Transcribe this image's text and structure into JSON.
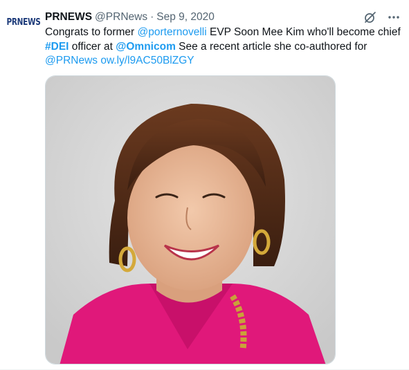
{
  "tweet": {
    "avatar_text": "PRNEWS",
    "display_name": "PRNEWS",
    "handle": "@PRNews",
    "separator": "·",
    "date": "Sep 9, 2020",
    "text": {
      "l1_a": "Congrats to former ",
      "l1_mention": "@porternovelli",
      "l1_b": "  EVP Soon Mee Kim who'll become chief",
      "l2_hashtag": "#DEI",
      "l2_a": " officer at ",
      "l2_mention": "@Omnicom",
      "l2_b": "  See a recent article she co-authored for",
      "l3_mention": "@PRNews",
      "l3_space": " ",
      "l3_link": "ow.ly/l9AC50BlZGY"
    },
    "icons": {
      "grok": "grok-icon",
      "more": "more-options-icon"
    }
  },
  "colors": {
    "link": "#1d9bf0",
    "text": "#0f1419",
    "muted": "#536471",
    "photo_background": "#d9d9d9",
    "blouse": "#e0187a",
    "hair": "#4a2817"
  }
}
